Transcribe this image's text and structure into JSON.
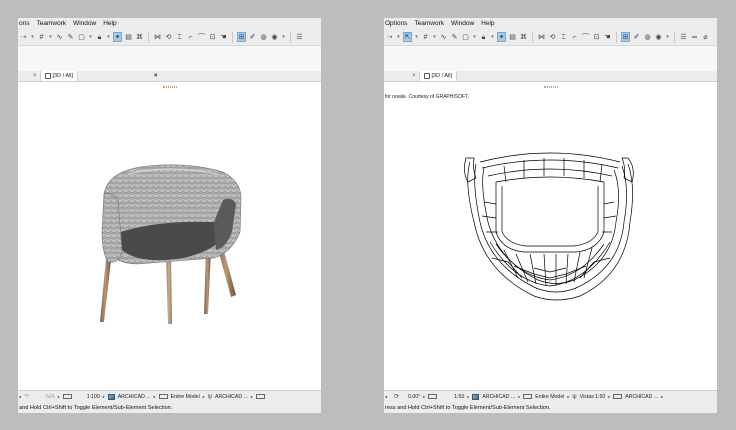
{
  "left": {
    "menu": [
      "ons",
      "Teamwork",
      "Window",
      "Help"
    ],
    "tab": {
      "label": "[3D / All]"
    },
    "status": {
      "dim1": "N/A",
      "scale": "1:100",
      "layer": "ARCHICAD ...",
      "model": "Entire Model",
      "view": "ARCHICAD ..."
    },
    "hint": "and Hold Ctrl+Shift to Toggle Element/Sub-Element Selection."
  },
  "right": {
    "menu": [
      "Options",
      "Teamwork",
      "Window",
      "Help"
    ],
    "tab": {
      "label": "[3D / All]"
    },
    "caption": "for resale. Courtesy of GRAPHISOFT.",
    "status": {
      "angle": "0,00°",
      "scale": "1:50",
      "layer": "ARCHICAD ...",
      "model": "Entire Model",
      "view": "Vistas 1:50",
      "view2": "ARCHICAD ..."
    },
    "hint": "ress and Hold Ctrl+Shift to Toggle Element/Sub-Element Selection."
  },
  "colors": {
    "background": "#bdbdbd",
    "toolbar": "#ececec",
    "selected_tool": "#a8cbe8"
  }
}
